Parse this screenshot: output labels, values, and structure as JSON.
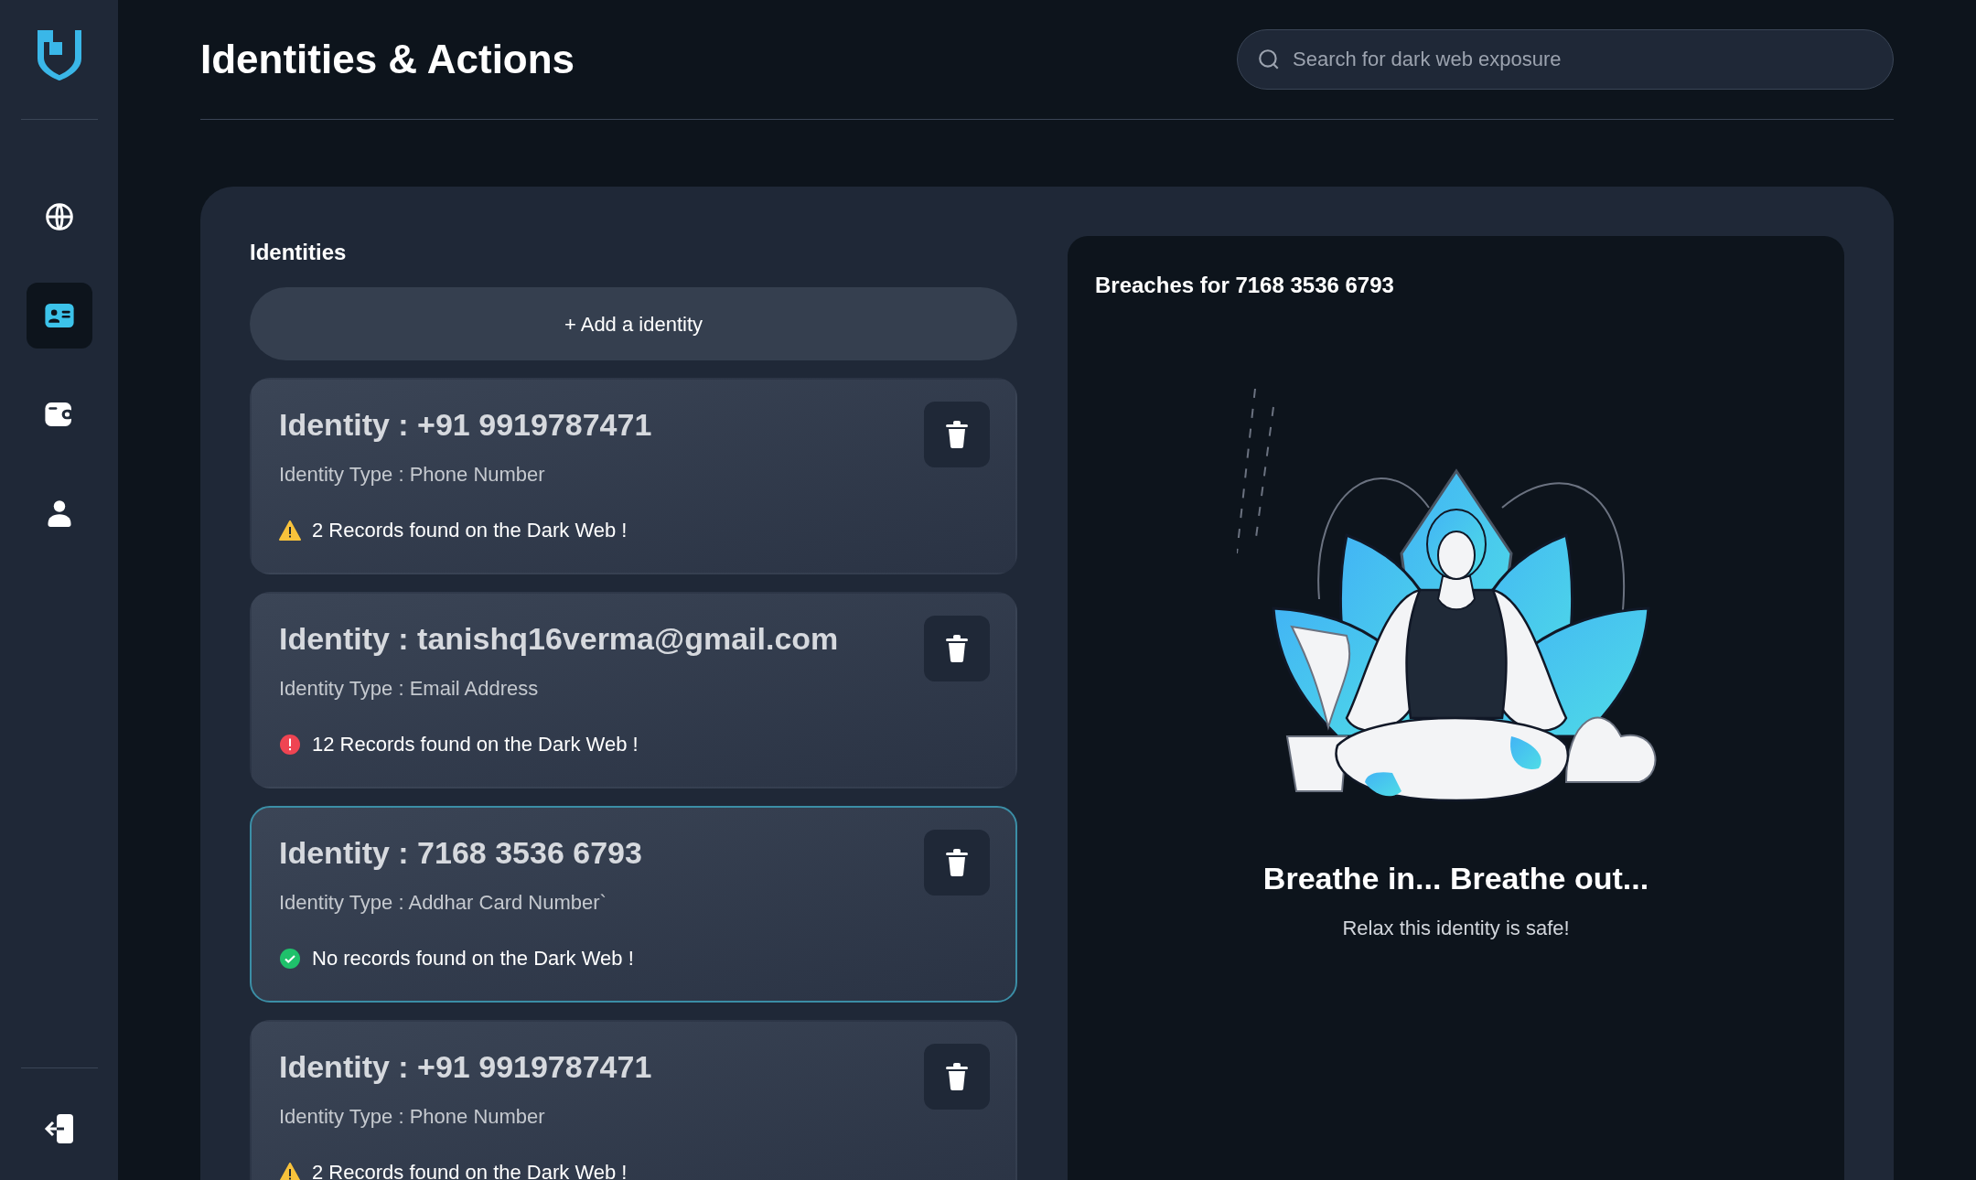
{
  "sidebar": {
    "items": [
      {
        "kind": "globe",
        "selected": false
      },
      {
        "kind": "card",
        "selected": true
      },
      {
        "kind": "wallet",
        "selected": false
      },
      {
        "kind": "user",
        "selected": false
      }
    ]
  },
  "header": {
    "title": "Identities & Actions",
    "search": {
      "placeholder": "Search for dark web exposure"
    }
  },
  "identities": {
    "heading": "Identities",
    "add_button": "+ Add a identity",
    "cards": [
      {
        "title": "Identity : +91 9919787471",
        "type": "Identity Type : Phone Number",
        "status": "2 Records found on the Dark Web !",
        "kind": "warning",
        "selected": false
      },
      {
        "title": "Identity : tanishq16verma@gmail.com",
        "type": "Identity Type : Email Address",
        "status": "12 Records found on the Dark Web !",
        "kind": "danger",
        "selected": false
      },
      {
        "title": "Identity : 7168 3536 6793",
        "type": "Identity Type : Addhar Card Number`",
        "status": "No records found on the Dark Web !",
        "kind": "safe",
        "selected": true
      },
      {
        "title": "Identity : +91 9919787471",
        "type": "Identity Type : Phone Number",
        "status": "2 Records found on the Dark Web !",
        "kind": "warning",
        "selected": false
      }
    ]
  },
  "breaches": {
    "title": "Breaches for 7168 3536 6793",
    "message_title": "Breathe in... Breathe out...",
    "message": "Relax this identity is safe!"
  }
}
